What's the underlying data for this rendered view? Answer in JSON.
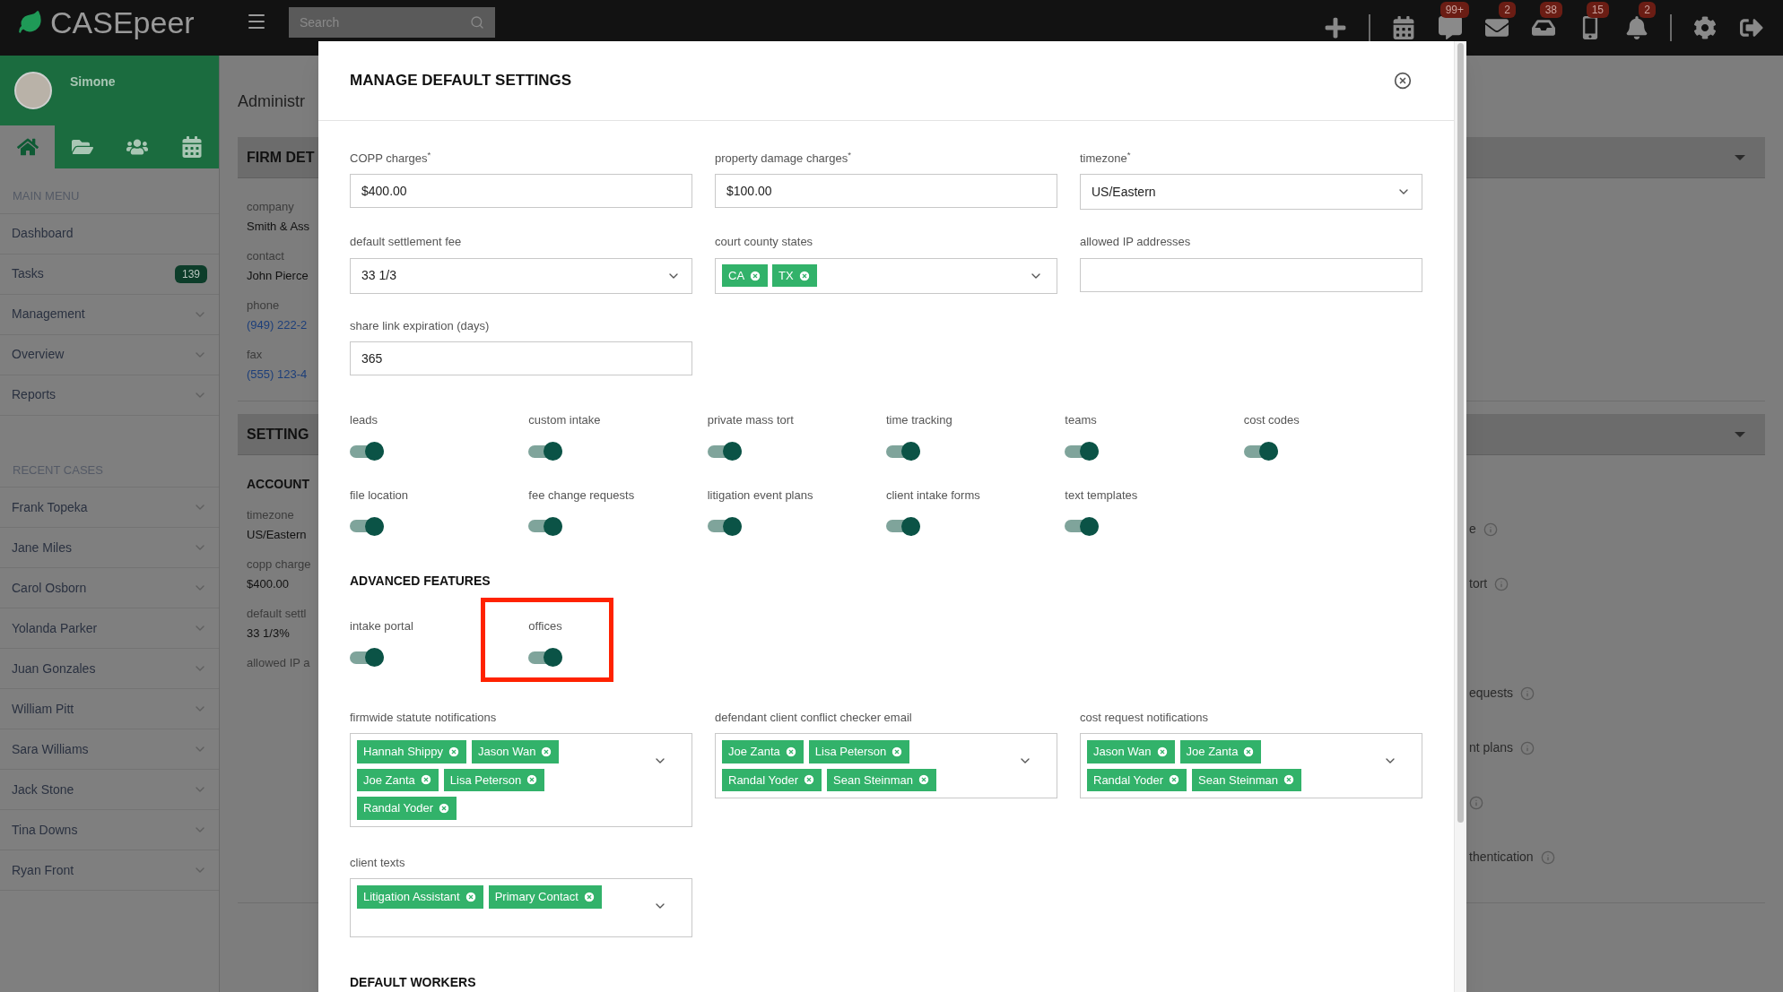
{
  "topbar": {
    "logo": "CASEpeer",
    "search_placeholder": "Search",
    "icons": [
      {
        "kind": "plus",
        "separator_after": true
      },
      {
        "kind": "calendar",
        "separator_after": false
      },
      {
        "kind": "message",
        "badge": "99+",
        "separator_after": false
      },
      {
        "kind": "mail",
        "badge": "2",
        "separator_after": false
      },
      {
        "kind": "inbox",
        "badge": "38",
        "separator_after": false
      },
      {
        "kind": "phone",
        "badge": "15",
        "separator_after": false
      },
      {
        "kind": "bell",
        "badge": "2",
        "separator_after": true
      },
      {
        "kind": "settings",
        "separator_after": false
      },
      {
        "kind": "logout",
        "separator_after": false
      }
    ]
  },
  "sidebar": {
    "user": "Simone",
    "tabs": [
      {
        "kind": "home",
        "selected": true
      },
      {
        "kind": "folder",
        "selected": false
      },
      {
        "kind": "users",
        "selected": false
      },
      {
        "kind": "calendar",
        "selected": false
      }
    ],
    "sections": [
      {
        "title": "MAIN MENU",
        "items": [
          {
            "label": "Dashboard",
            "expandable": false
          },
          {
            "label": "Tasks",
            "badge": "139",
            "expandable": false
          },
          {
            "label": "Management",
            "expandable": true
          },
          {
            "label": "Overview",
            "expandable": true
          },
          {
            "label": "Reports",
            "expandable": true
          }
        ]
      },
      {
        "title": "RECENT CASES",
        "items": [
          {
            "label": "Frank Topeka",
            "expandable": true
          },
          {
            "label": "Jane Miles",
            "expandable": true
          },
          {
            "label": "Carol Osborn",
            "expandable": true
          },
          {
            "label": "Yolanda Parker",
            "expandable": true
          },
          {
            "label": "Juan Gonzales",
            "expandable": true
          },
          {
            "label": "William Pitt",
            "expandable": true
          },
          {
            "label": "Sara Williams",
            "expandable": true
          },
          {
            "label": "Jack Stone",
            "expandable": true
          },
          {
            "label": "Tina Downs",
            "expandable": true
          },
          {
            "label": "Ryan Front",
            "expandable": true
          }
        ]
      }
    ]
  },
  "page": {
    "title": "Administr",
    "panels": [
      {
        "title": "FIRM DET",
        "fields": [
          {
            "label": "company",
            "value": "Smith & Ass",
            "kind": "text"
          },
          {
            "label": "contact",
            "value": "John Pierce",
            "kind": "text"
          },
          {
            "label": "phone",
            "value": "(949) 222-2",
            "kind": "link"
          },
          {
            "label": "fax",
            "value": "(555) 123-4",
            "kind": "link"
          }
        ]
      },
      {
        "title": "SETTING",
        "subtitle": "ACCOUNT",
        "fields": [
          {
            "label": "timezone",
            "value": "US/Eastern",
            "kind": "text"
          },
          {
            "label": "copp charge",
            "value": "$400.00",
            "kind": "text"
          },
          {
            "label": "default settl",
            "value": "33 1/3%",
            "kind": "text"
          },
          {
            "label": "allowed IP a"
          }
        ],
        "right_items": [
          {
            "text": "e"
          },
          {
            "text": "tort"
          },
          {
            "text": "equests"
          },
          {
            "text": "nt plans"
          },
          {
            "info_only": true
          },
          {
            "text": "thentication"
          }
        ]
      }
    ]
  },
  "modal": {
    "title": "MANAGE DEFAULT SETTINGS",
    "fields": [
      {
        "kind": "text",
        "label": "COPP charges$^{*}$",
        "value": "$400.00"
      },
      {
        "kind": "text",
        "label": "property damage charges$^{*}$",
        "value": "$100.00"
      },
      {
        "kind": "select",
        "label": "timezone$^{*}$",
        "value": "US/Eastern"
      },
      {
        "kind": "select",
        "label": "default settlement fee",
        "value": "33 1/3"
      },
      {
        "kind": "tags",
        "label": "court county states",
        "tags": [
          "CA",
          "TX"
        ]
      },
      {
        "kind": "text",
        "label": "allowed IP addresses"
      },
      {
        "kind": "text",
        "label": "share link expiration (days)",
        "value": "365"
      }
    ],
    "toggles": [
      {
        "label": "leads",
        "on": true
      },
      {
        "label": "custom intake",
        "on": true
      },
      {
        "label": "private mass tort",
        "on": true
      },
      {
        "label": "time tracking",
        "on": true
      },
      {
        "label": "teams",
        "on": true
      },
      {
        "label": "cost codes",
        "on": true
      },
      {
        "label": "file location",
        "on": true
      },
      {
        "label": "fee change requests",
        "on": true
      },
      {
        "label": "litigation event plans",
        "on": true
      },
      {
        "label": "client intake forms",
        "on": true
      },
      {
        "label": "text templates",
        "on": true
      }
    ],
    "advanced": {
      "title": "ADVANCED FEATURES",
      "toggles": [
        {
          "label": "intake portal",
          "on": true,
          "highlighted": false
        },
        {
          "label": "offices",
          "on": true,
          "highlighted": true
        }
      ]
    },
    "notifications": [
      {
        "label": "firmwide statute notifications",
        "tags": [
          "Hannah Shippy",
          "Jason Wan",
          "Joe Zanta",
          "Lisa Peterson",
          "Randal Yoder"
        ]
      },
      {
        "label": "defendant client conflict checker email",
        "tags": [
          "Joe Zanta",
          "Lisa Peterson",
          "Randal Yoder",
          "Sean Steinman"
        ]
      },
      {
        "label": "cost request notifications",
        "tags": [
          "Jason Wan",
          "Joe Zanta",
          "Randal Yoder",
          "Sean Steinman"
        ]
      },
      {
        "label": "client texts",
        "tags": [
          "Litigation Assistant",
          "Primary Contact"
        ]
      }
    ],
    "footer_title": "DEFAULT WORKERS"
  }
}
